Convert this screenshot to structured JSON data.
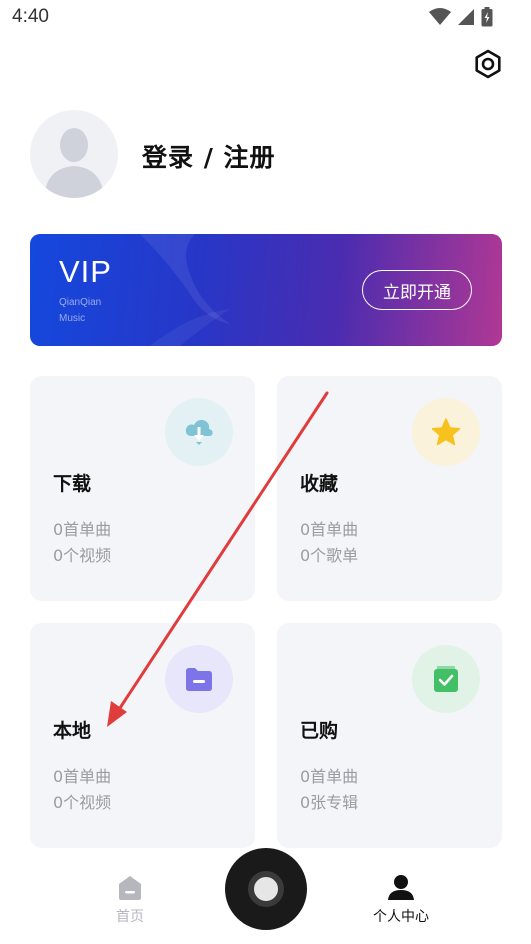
{
  "status_bar": {
    "time": "4:40"
  },
  "profile": {
    "login_label": "登录 / 注册"
  },
  "vip": {
    "title": "VIP",
    "subtitle_line1": "QianQian",
    "subtitle_line2": "Music",
    "button_label": "立即开通"
  },
  "cards": [
    {
      "title": "下载",
      "line1": "0首单曲",
      "line2": "0个视频",
      "icon": "cloud-download-icon",
      "icon_bg": "#e4f1f4",
      "icon_color": "#7fc3d4"
    },
    {
      "title": "收藏",
      "line1": "0首单曲",
      "line2": "0个歌单",
      "icon": "star-icon",
      "icon_bg": "#fbf2dc",
      "icon_color": "#f7c21e"
    },
    {
      "title": "本地",
      "line1": "0首单曲",
      "line2": "0个视频",
      "icon": "folder-icon",
      "icon_bg": "#e8e6fb",
      "icon_color": "#7d74e8"
    },
    {
      "title": "已购",
      "line1": "0首单曲",
      "line2": "0张专辑",
      "icon": "purchased-icon",
      "icon_bg": "#e1f3e6",
      "icon_color": "#43c066"
    }
  ],
  "bottom_nav": {
    "home_label": "首页",
    "profile_label": "个人中心"
  },
  "colors": {
    "annotation_arrow": "#e03c3c",
    "nav_inactive": "#b5b7bd",
    "nav_active": "#111111"
  }
}
